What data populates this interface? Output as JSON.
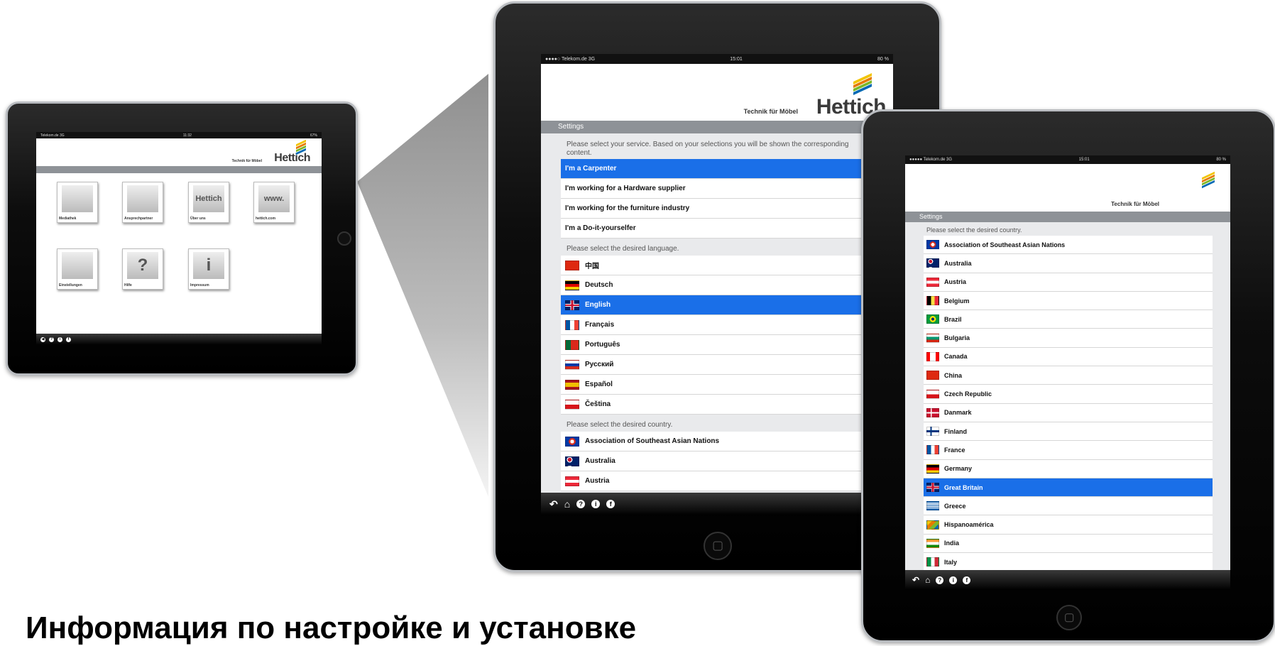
{
  "caption": "Информация по настройке и установке",
  "small_ipad": {
    "status_left": "Telekom.de  3G",
    "status_center": "11:32",
    "status_right": "67%",
    "tagline": "Technik für Möbel",
    "logo": "Hettich",
    "tiles": [
      {
        "label": "Mediathek",
        "icon": "media-icon"
      },
      {
        "label": "Ansprechpartner",
        "icon": "contact-icon"
      },
      {
        "label": "Über uns",
        "icon": "hettich-logo-icon",
        "inner": "Hettich"
      },
      {
        "label": "hettich.com",
        "icon": "web-icon",
        "inner": "www."
      },
      {
        "label": "Einstellungen",
        "icon": "gears-icon"
      },
      {
        "label": "Hilfe",
        "icon": "help-icon",
        "inner": "?"
      },
      {
        "label": "Impressum",
        "icon": "info-icon",
        "inner": "i"
      }
    ]
  },
  "middle_ipad": {
    "status_left": "●●●●○ Telekom.de  3G",
    "status_center": "15:01",
    "status_right": "80 %",
    "tagline": "Technik für Möbel",
    "logo": "Hettich",
    "settings_title": "Settings",
    "service_prompt": "Please select your service. Based on your selections you will be shown the corresponding content.",
    "services": [
      {
        "label": "I'm a Carpenter",
        "selected": true
      },
      {
        "label": "I'm working for a Hardware supplier",
        "selected": false
      },
      {
        "label": "I'm working for the furniture industry",
        "selected": false
      },
      {
        "label": "I'm a Do-it-yourselfer",
        "selected": false
      }
    ],
    "language_prompt": "Please select the desired language.",
    "languages": [
      {
        "label": "中国",
        "flag": "china",
        "selected": false
      },
      {
        "label": "Deutsch",
        "flag": "germany",
        "selected": false
      },
      {
        "label": "English",
        "flag": "uk",
        "selected": true
      },
      {
        "label": "Français",
        "flag": "france",
        "selected": false
      },
      {
        "label": "Português",
        "flag": "portugal",
        "selected": false
      },
      {
        "label": "Русский",
        "flag": "russia",
        "selected": false
      },
      {
        "label": "Español",
        "flag": "spain",
        "selected": false
      },
      {
        "label": "Čeština",
        "flag": "czech",
        "selected": false
      }
    ],
    "country_prompt": "Please select the desired country.",
    "countries": [
      {
        "label": "Association of Southeast Asian Nations",
        "flag": "asean"
      },
      {
        "label": "Australia",
        "flag": "australia"
      },
      {
        "label": "Austria",
        "flag": "austria"
      }
    ]
  },
  "right_ipad": {
    "status_left": "●●●●● Telekom.de  3G",
    "status_center": "15:01",
    "status_right": "80 %",
    "tagline": "Technik für Möbel",
    "settings_title": "Settings",
    "country_prompt": "Please select the desired country.",
    "countries": [
      {
        "label": "Association of Southeast Asian Nations",
        "flag": "asean",
        "selected": false
      },
      {
        "label": "Australia",
        "flag": "australia",
        "selected": false
      },
      {
        "label": "Austria",
        "flag": "austria",
        "selected": false
      },
      {
        "label": "Belgium",
        "flag": "belgium",
        "selected": false
      },
      {
        "label": "Brazil",
        "flag": "brazil",
        "selected": false
      },
      {
        "label": "Bulgaria",
        "flag": "bulgaria",
        "selected": false
      },
      {
        "label": "Canada",
        "flag": "canada",
        "selected": false
      },
      {
        "label": "China",
        "flag": "china",
        "selected": false
      },
      {
        "label": "Czech Republic",
        "flag": "czech",
        "selected": false
      },
      {
        "label": "Danmark",
        "flag": "denmark",
        "selected": false
      },
      {
        "label": "Finland",
        "flag": "finland",
        "selected": false
      },
      {
        "label": "France",
        "flag": "france",
        "selected": false
      },
      {
        "label": "Germany",
        "flag": "germany",
        "selected": false
      },
      {
        "label": "Great Britain",
        "flag": "uk",
        "selected": true
      },
      {
        "label": "Greece",
        "flag": "greece",
        "selected": false
      },
      {
        "label": "Hispanoamérica",
        "flag": "hettich",
        "selected": false
      },
      {
        "label": "India",
        "flag": "india",
        "selected": false
      },
      {
        "label": "Italy",
        "flag": "italy",
        "selected": false
      }
    ]
  },
  "footer_icons": [
    "back-icon",
    "home-icon",
    "help-icon",
    "info-icon",
    "facebook-icon"
  ],
  "colors": {
    "selected_row": "#1a6fe8",
    "settings_bar": "#8e9297",
    "accent_stripes": [
      "#f2c400",
      "#e67a00",
      "#d2001a",
      "#7cb829",
      "#0069b4"
    ]
  }
}
